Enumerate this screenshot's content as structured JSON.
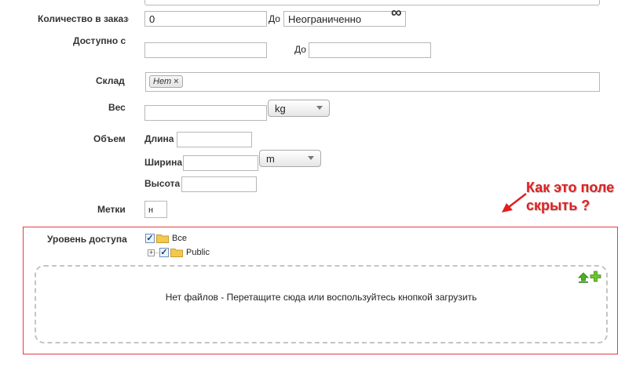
{
  "form": {
    "order_quantity": {
      "label": "Количество в заказе",
      "from_value": "0",
      "to_label": "До",
      "to_value": "Неограниченно",
      "infinity_symbol": "∞"
    },
    "available_from": {
      "label": "Доступно с",
      "from_value": "",
      "to_label": "До",
      "to_value": ""
    },
    "warehouse": {
      "label": "Склад",
      "tag_label": "Нет",
      "tag_remove": "×"
    },
    "weight": {
      "label": "Вес",
      "value": "",
      "unit_selected": "kg"
    },
    "volume": {
      "label": "Объем",
      "length_label": "Длина",
      "length_value": "",
      "width_label": "Ширина",
      "width_value": "",
      "unit_selected": "m",
      "height_label": "Высота",
      "height_value": ""
    },
    "tags": {
      "label": "Метки",
      "value": "н"
    },
    "access_level": {
      "label": "Уровень доступа",
      "tree": [
        {
          "label": "Все",
          "checked": true,
          "expandable": false
        },
        {
          "label": "Public",
          "checked": true,
          "expandable": true
        }
      ]
    },
    "upload": {
      "message": "Нет файлов - Перетащите сюда или воспользуйтесь кнопкой загрузить",
      "upload_icon": "upload-arrow-icon",
      "add_icon": "add-plus-icon"
    }
  },
  "annotation": {
    "line1": "Как это поле",
    "line2": "скрыть ?"
  },
  "colors": {
    "annotation_red": "#e02020",
    "checkbox_blue": "#1a3d7a",
    "folder_yellow": "#f2c94c",
    "upload_green": "#4caf20"
  }
}
